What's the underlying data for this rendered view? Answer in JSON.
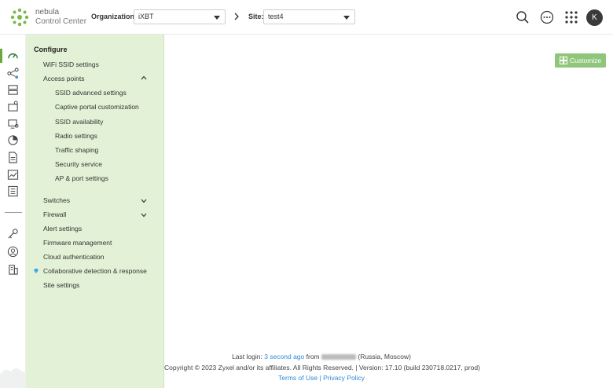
{
  "header": {
    "brand_line1": "nebula",
    "brand_line2": "Control Center",
    "org_label": "Organization:",
    "org_value": "iXBT",
    "site_label": "Site:",
    "site_value": "test4",
    "avatar_initial": "K"
  },
  "menu": {
    "heading": "Configure",
    "items": [
      "WiFi SSID settings",
      "Access points",
      "SSID advanced settings",
      "Captive portal customization",
      "SSID availability",
      "Radio settings",
      "Traffic shaping",
      "Security service",
      "AP & port settings",
      "Switches",
      "Firewall",
      "Alert settings",
      "Firmware management",
      "Cloud authentication",
      "Collaborative detection & response",
      "Site settings"
    ]
  },
  "main": {
    "customize_label": "Customize"
  },
  "footer": {
    "last_login_label": "Last login:",
    "last_login_value": "3 second ago",
    "from_label": "from",
    "location": "(Russia, Moscow)",
    "copyright": "Copyright © 2023 Zyxel and/or its affiliates. All Rights Reserved. | Version: 17.10 (build 230718.0217, prod)",
    "terms": "Terms of Use",
    "separator": "|",
    "privacy": "Privacy Policy"
  },
  "colors": {
    "accent": "#6aaa3a",
    "menu_bg": "#e3f2d6",
    "link": "#2e8ad8",
    "button": "#8fc67a"
  }
}
